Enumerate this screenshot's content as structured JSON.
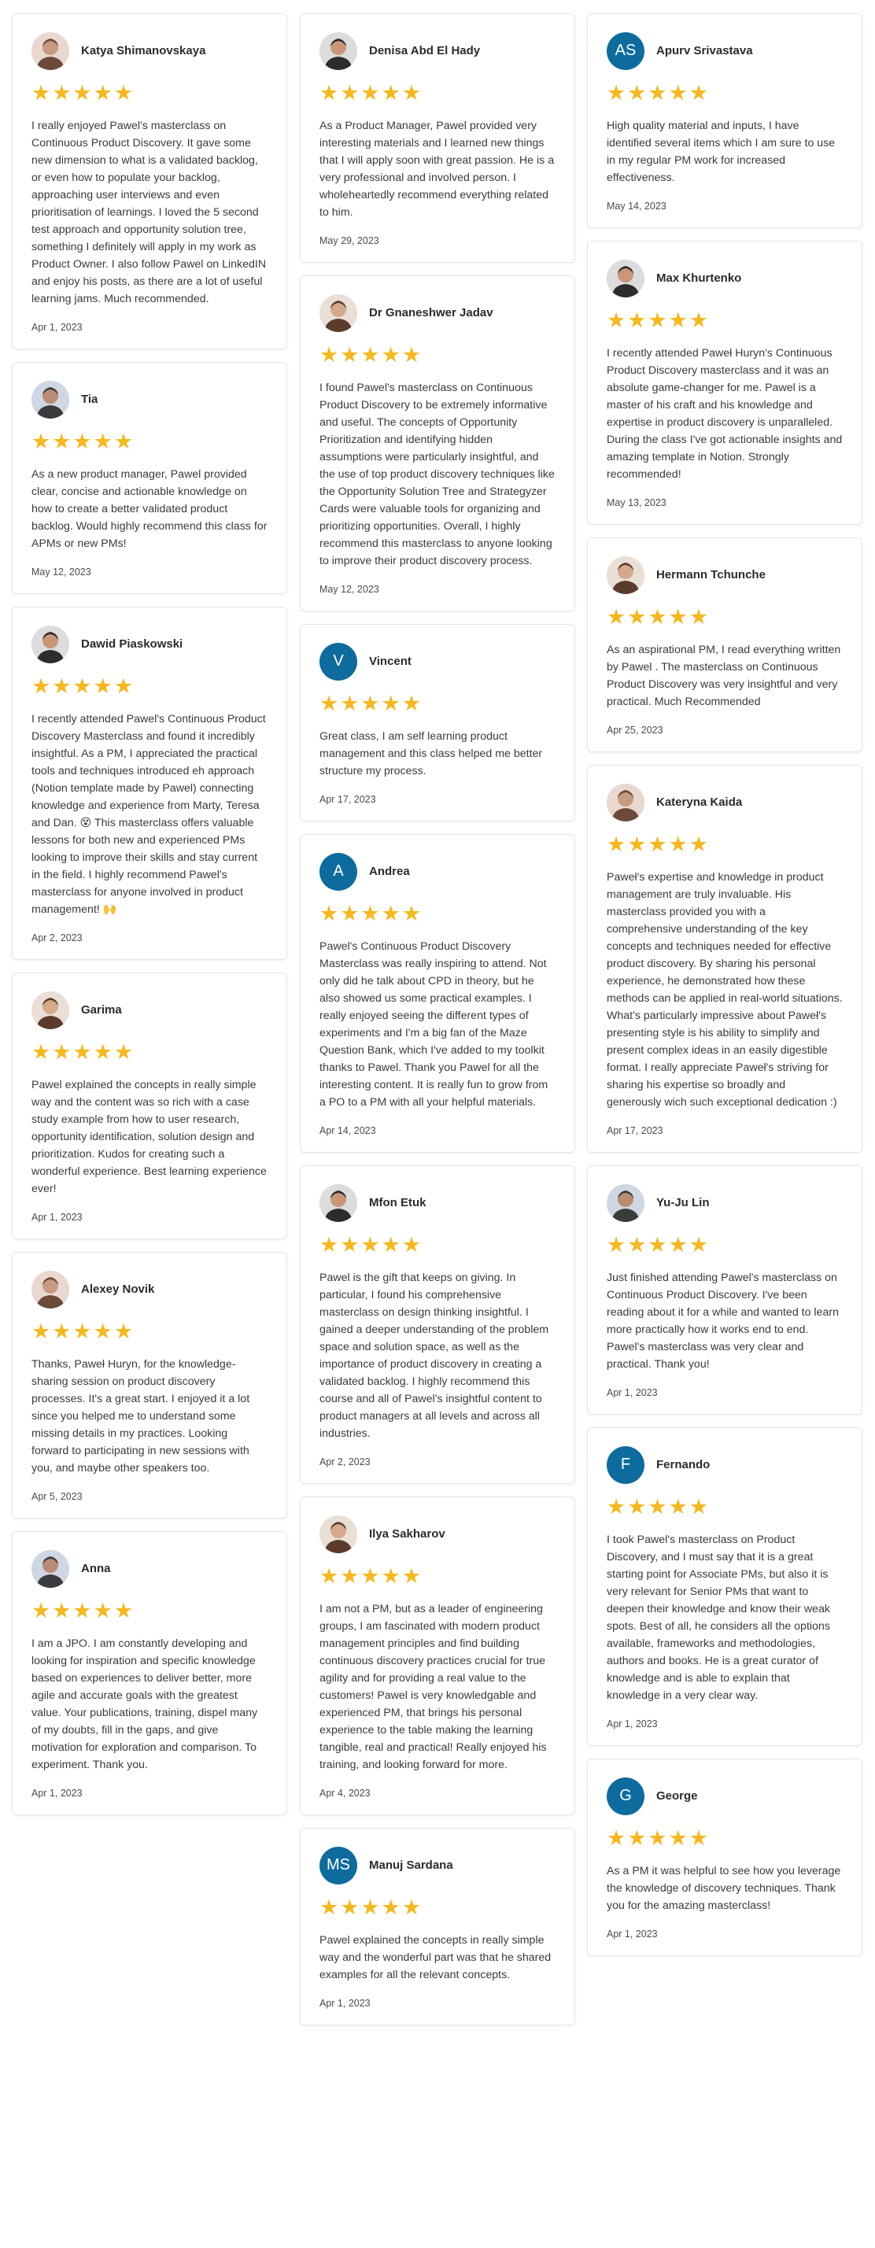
{
  "colors": {
    "star": "#f5b81e",
    "initials_bg": "#0d6b9e"
  },
  "star_glyphs": "★★★★★",
  "columns": [
    [
      {
        "name": "Katya Shimanovskaya",
        "avatar": "photo",
        "rating": 5,
        "text": "I really enjoyed Pawel's masterclass on Continuous Product Discovery. It gave some new dimension to what is a validated backlog, or even how to populate your backlog, approaching user interviews and even prioritisation of learnings. I loved the 5 second test approach and opportunity solution tree, something I definitely will apply in my work as Product Owner. I also follow Pawel on LinkedIN and enjoy his posts, as there are a lot of useful learning jams. Much recommended.",
        "date": "Apr 1, 2023"
      },
      {
        "name": "Tia",
        "avatar": "photo",
        "rating": 5,
        "text": "As a new product manager, Pawel provided clear, concise and actionable knowledge on how to create a better validated product backlog. Would highly recommend this class for APMs or new PMs!",
        "date": "May 12, 2023"
      },
      {
        "name": "Dawid Piaskowski",
        "avatar": "photo",
        "rating": 5,
        "text": "I recently attended Pawel's Continuous Product Discovery Masterclass and found it incredibly insightful. As a PM, I appreciated the practical tools and techniques introduced eh approach (Notion template made by Pawel) connecting knowledge and experience from Marty, Teresa and Dan. 😵 This masterclass offers valuable lessons for both new and experienced PMs looking to improve their skills and stay current in the field. I highly recommend Pawel's masterclass for anyone involved in product management! 🙌",
        "date": "Apr 2, 2023"
      },
      {
        "name": "Garima",
        "avatar": "photo",
        "rating": 5,
        "text": "Pawel explained the concepts in really simple way and the content was so rich with a case study example from how to user research, opportunity identification, solution design and prioritization. Kudos for creating such a wonderful experience. Best learning experience ever!",
        "date": "Apr 1, 2023"
      },
      {
        "name": "Alexey Novik",
        "avatar": "photo",
        "rating": 5,
        "text": "Thanks, Paweł Huryn, for the knowledge-sharing session on product discovery processes. It's a great start. I enjoyed it a lot since you helped me to understand some missing details in my practices. Looking forward to participating in new sessions with you, and maybe other speakers too.",
        "date": "Apr 5, 2023"
      },
      {
        "name": "Anna",
        "avatar": "photo",
        "rating": 5,
        "text": "I am a JPO. I am constantly developing and looking for inspiration and specific knowledge based on experiences to deliver better, more agile and accurate goals with the greatest value. Your publications, training, dispel many of my doubts, fill in the gaps, and give motivation for exploration and comparison. To experiment. Thank you.",
        "date": "Apr 1, 2023"
      }
    ],
    [
      {
        "name": "Denisa Abd El Hady",
        "avatar": "photo",
        "rating": 5,
        "text": "As a Product Manager, Pawel provided very interesting materials and I learned new things that I will apply soon with great passion. He is a very professional and involved person. I wholeheartedly recommend everything related to him.",
        "date": "May 29, 2023"
      },
      {
        "name": "Dr Gnaneshwer Jadav",
        "avatar": "photo",
        "rating": 5,
        "text": "I found Pawel's masterclass on Continuous Product Discovery to be extremely informative and useful. The concepts of Opportunity Prioritization and identifying hidden assumptions were particularly insightful, and the use of top product discovery techniques like the Opportunity Solution Tree and Strategyzer Cards were valuable tools for organizing and prioritizing opportunities. Overall, I highly recommend this masterclass to anyone looking to improve their product discovery process.",
        "date": "May 12, 2023"
      },
      {
        "name": "Vincent",
        "avatar": "initials",
        "initials": "V",
        "rating": 5,
        "text": "Great class, I am self learning product management and this class helped me better structure my process.",
        "date": "Apr 17, 2023"
      },
      {
        "name": "Andrea",
        "avatar": "initials",
        "initials": "A",
        "rating": 5,
        "text": "Pawel's Continuous Product Discovery Masterclass was really inspiring to attend. Not only did he talk about CPD in theory, but he also showed us some practical examples. I really enjoyed seeing the different types of experiments and I'm a big fan of the Maze Question Bank, which I've added to my toolkit thanks to Pawel. Thank you Pawel for all the interesting content. It is really fun to grow from a PO to a PM with all your helpful materials.",
        "date": "Apr 14, 2023"
      },
      {
        "name": "Mfon Etuk",
        "avatar": "photo",
        "rating": 5,
        "text": "Pawel is the gift that keeps on giving. In particular, I found his comprehensive masterclass on design thinking insightful. I gained a deeper understanding of the problem space and solution space, as well as the importance of product discovery in creating a validated backlog. I highly recommend this course and all of Pawel's insightful content to product managers at all levels and across all industries.",
        "date": "Apr 2, 2023"
      },
      {
        "name": "Ilya Sakharov",
        "avatar": "photo",
        "rating": 5,
        "text": "I am not a PM, but as a leader of engineering groups, I am fascinated with modern product management principles and find building continuous discovery practices crucial for true agility and for providing a real value to the customers! Pawel is very knowledgable and experienced PM, that brings his personal experience to the table making the learning tangible, real and practical! Really enjoyed his training, and looking forward for more.",
        "date": "Apr 4, 2023"
      },
      {
        "name": "Manuj Sardana",
        "avatar": "initials",
        "initials": "MS",
        "rating": 5,
        "text": "Pawel explained the concepts in really simple way and the wonderful part was that he shared examples for all the relevant concepts.",
        "date": "Apr 1, 2023"
      }
    ],
    [
      {
        "name": "Apurv Srivastava",
        "avatar": "initials",
        "initials": "AS",
        "rating": 5,
        "text": "High quality material and inputs, I have identified several items which I am sure to use in my regular PM work for increased effectiveness.",
        "date": "May 14, 2023"
      },
      {
        "name": "Max Khurtenko",
        "avatar": "photo",
        "rating": 5,
        "text": "I recently attended Paweł Huryn's Continuous Product Discovery masterclass and it was an absolute game-changer for me. Pawel is a master of his craft and his knowledge and expertise in product discovery is unparalleled. During the class I've got actionable insights and amazing template in Notion. Strongly recommended!",
        "date": "May 13, 2023"
      },
      {
        "name": "Hermann Tchunche",
        "avatar": "photo",
        "rating": 5,
        "text": "As an aspirational PM, I read everything written by Pawel . The masterclass on Continuous Product Discovery was very insightful and very practical. Much Recommended",
        "date": "Apr 25, 2023"
      },
      {
        "name": "Kateryna Kaida",
        "avatar": "photo",
        "rating": 5,
        "text": "Paweł's expertise and knowledge in product management are truly invaluable. His masterclass provided you with a comprehensive understanding of the key concepts and techniques needed for effective product discovery. By sharing his personal experience, he demonstrated how these methods can be applied in real-world situations. What's particularly impressive about Paweł's presenting style is his ability to simplify and present complex ideas in an easily digestible format. I really appreciate Paweł's striving for sharing his expertise so broadly and generously wich such exceptional dedication :)",
        "date": "Apr 17, 2023"
      },
      {
        "name": "Yu-Ju Lin",
        "avatar": "photo",
        "rating": 5,
        "text": "Just finished attending Pawel's masterclass on Continuous Product Discovery. I've been reading about it for a while and wanted to learn more practically how it works end to end. Pawel's masterclass was very clear and practical. Thank you!",
        "date": "Apr 1, 2023"
      },
      {
        "name": "Fernando",
        "avatar": "initials",
        "initials": "F",
        "rating": 5,
        "text": "I took Pawel's masterclass on Product Discovery, and I must say that it is a great starting point for Associate PMs, but also it is very relevant for Senior PMs that want to deepen their knowledge and know their weak spots. Best of all, he considers all the options available, frameworks and methodologies, authors and books. He is a great curator of knowledge and is able to explain that knowledge in a very clear way.",
        "date": "Apr 1, 2023"
      },
      {
        "name": "George",
        "avatar": "initials",
        "initials": "G",
        "rating": 5,
        "text": "As a PM it was helpful to see how you leverage the knowledge of discovery techniques. Thank you for the amazing masterclass!",
        "date": "Apr 1, 2023"
      }
    ]
  ]
}
